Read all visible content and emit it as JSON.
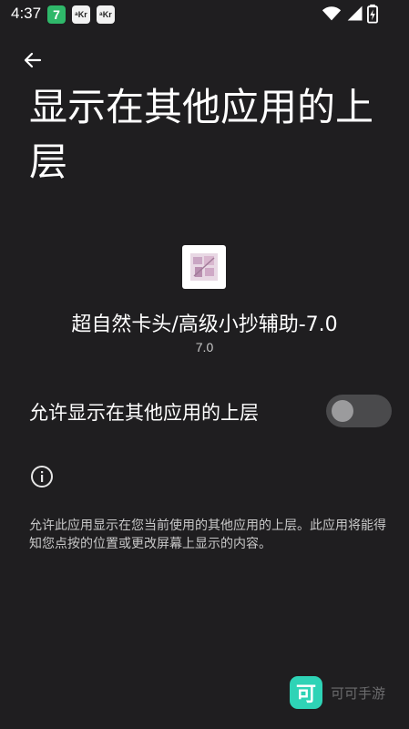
{
  "status_bar": {
    "time": "4:37",
    "notifications": [
      "7",
      "ᵃKr",
      "ᵃKr"
    ]
  },
  "header": {
    "title": "显示在其他应用的上层"
  },
  "app": {
    "name": "超自然卡头/高级小抄辅助-7.0",
    "version": "7.0"
  },
  "permission": {
    "label": "允许显示在其他应用的上层",
    "enabled": false
  },
  "description": "允许此应用显示在您当前使用的其他应用的上层。此应用将能得知您点按的位置或更改屏幕上显示的内容。",
  "watermark": {
    "logo_char": "可",
    "text": "可可手游"
  },
  "colors": {
    "background": "#1f1e20",
    "toggle_track": "#4a4a4c",
    "toggle_knob": "#9b9b9d",
    "watermark_accent": "#2ed3b6"
  }
}
